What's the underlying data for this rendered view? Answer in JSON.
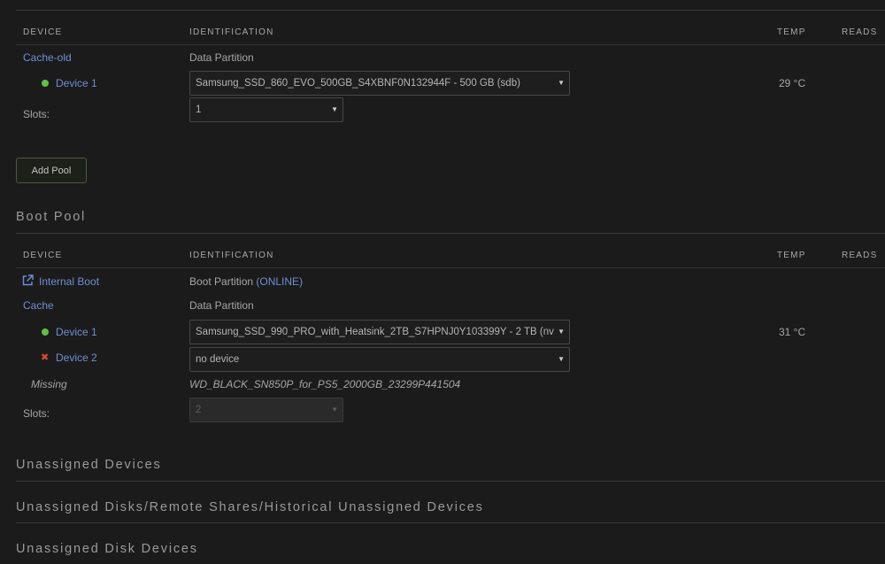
{
  "columns": {
    "device": "DEVICE",
    "identification": "IDENTIFICATION",
    "temp": "TEMP",
    "reads": "READS"
  },
  "cache_old": {
    "pool_name": "Cache-old",
    "partition": "Data Partition",
    "device1": {
      "label": "Device 1",
      "selected": "Samsung_SSD_860_EVO_500GB_S4XBNF0N132944F - 500 GB (sdb)",
      "temp": "29 °C",
      "status": "green"
    },
    "slots_label": "Slots:",
    "slots_value": "1"
  },
  "add_pool_label": "Add Pool",
  "boot_pool": {
    "title": "Boot Pool",
    "internal_boot": "Internal Boot",
    "boot_partition": "Boot Partition",
    "online": "(ONLINE)",
    "cache_name": "Cache",
    "partition": "Data Partition",
    "device1": {
      "label": "Device 1",
      "selected": "Samsung_SSD_990_PRO_with_Heatsink_2TB_S7HPNJ0Y103399Y - 2 TB (nv",
      "temp": "31 °C",
      "status": "green"
    },
    "device2": {
      "label": "Device 2",
      "selected": "no device",
      "status": "red"
    },
    "missing_label": "Missing",
    "missing_id": "WD_BLACK_SN850P_for_PS5_2000GB_23299P441504",
    "slots_label": "Slots:",
    "slots_value": "2"
  },
  "sections": {
    "unassigned_devices": "Unassigned Devices",
    "unassigned_disks": "Unassigned Disks/Remote Shares/Historical Unassigned Devices",
    "unassigned_disk_devices": "Unassigned Disk Devices"
  },
  "colors": {
    "link": "#6d8fd6",
    "online": "#5fc045",
    "error": "#e0492b"
  }
}
